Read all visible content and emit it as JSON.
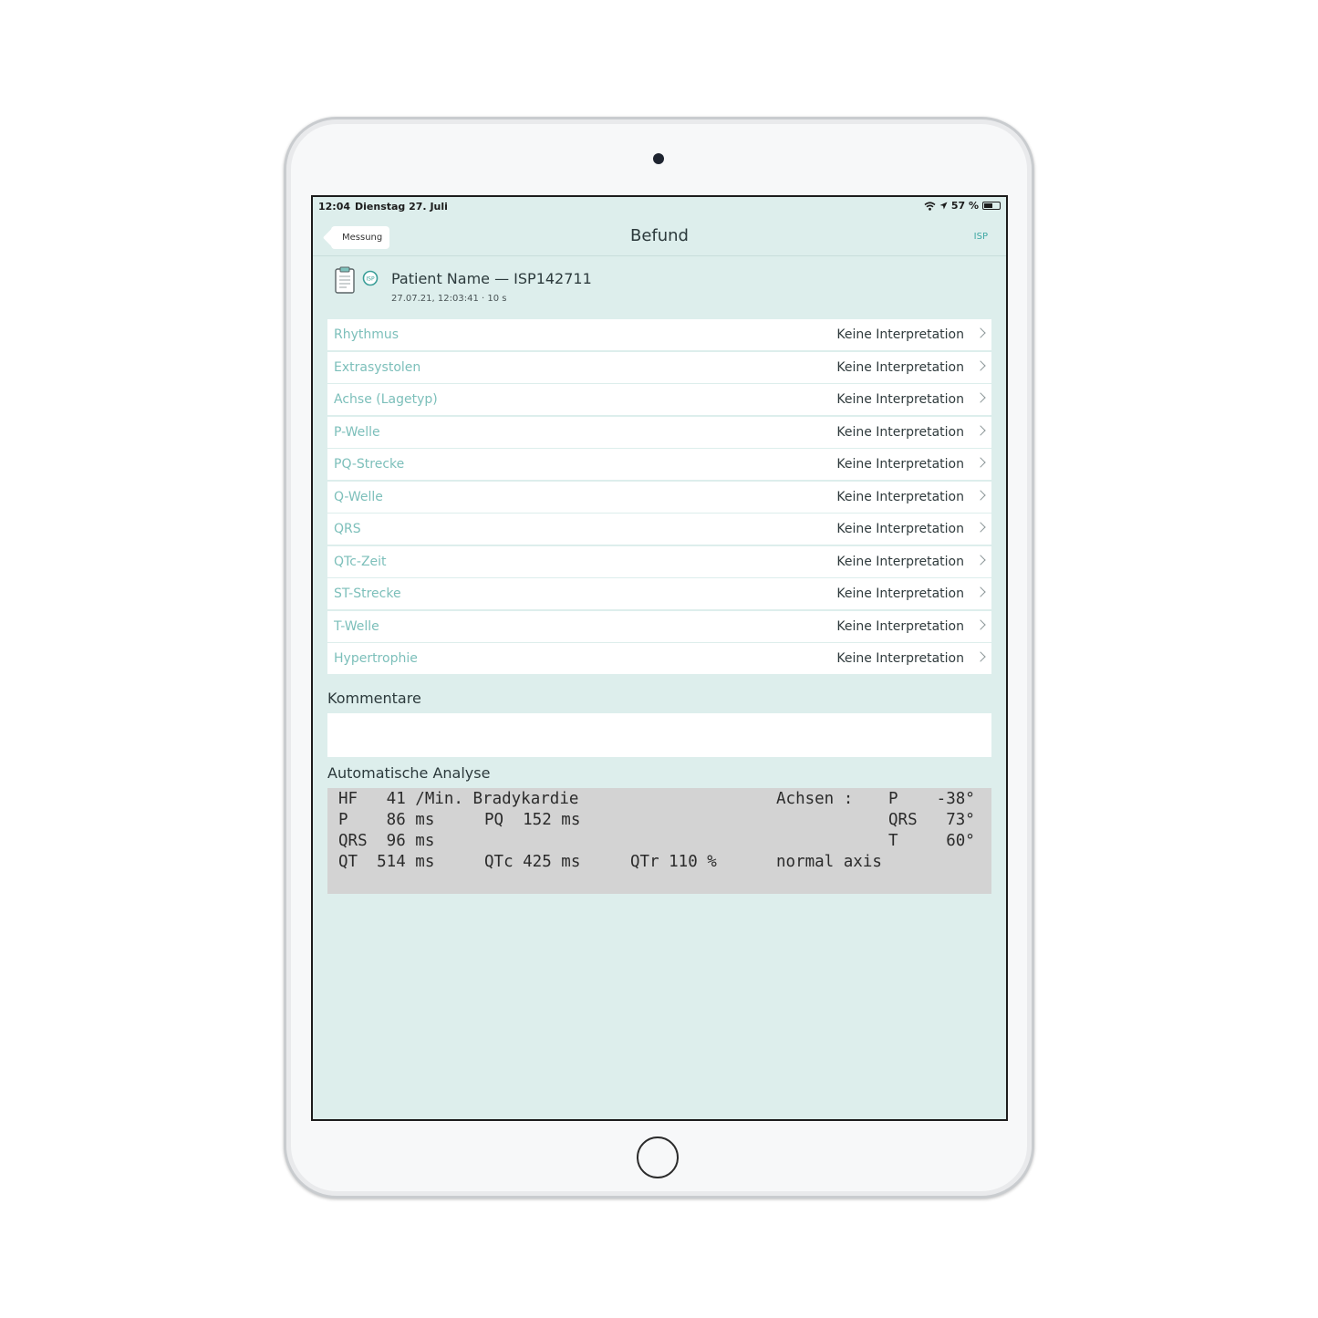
{
  "status_bar": {
    "time": "12:04",
    "date": "Dienstag 27. Juli",
    "battery": "57 %",
    "battery_level": 0.57
  },
  "nav": {
    "back_label": "Messung",
    "title": "Befund",
    "right_label": "ISP"
  },
  "patient": {
    "name": "Patient Name — ISP142711",
    "meta": "27.07.21, 12:03:41 · 10 s",
    "icon_label": "ISP"
  },
  "findings": [
    {
      "label": "Rhythmus",
      "value": "Keine Interpretation"
    },
    {
      "label": "Extrasystolen",
      "value": "Keine Interpretation"
    },
    {
      "label": "Achse (Lagetyp)",
      "value": "Keine Interpretation"
    },
    {
      "label": "P-Welle",
      "value": "Keine Interpretation"
    },
    {
      "label": "PQ-Strecke",
      "value": "Keine Interpretation"
    },
    {
      "label": "Q-Welle",
      "value": "Keine Interpretation"
    },
    {
      "label": "QRS",
      "value": "Keine Interpretation"
    },
    {
      "label": "QTc-Zeit",
      "value": "Keine Interpretation"
    },
    {
      "label": "ST-Strecke",
      "value": "Keine Interpretation"
    },
    {
      "label": "T-Welle",
      "value": "Keine Interpretation"
    },
    {
      "label": "Hypertrophie",
      "value": "Keine Interpretation"
    }
  ],
  "comments": {
    "title": "Kommentare",
    "value": ""
  },
  "analysis": {
    "title": "Automatische Analyse",
    "hf": "HF   41 /Min. Bradykardie",
    "p": "P    86 ms",
    "pq": "PQ  152 ms",
    "qrs": "QRS  96 ms",
    "qt": "QT  514 ms",
    "qtc": "QTc 425 ms",
    "qtr": "QTr 110 %",
    "axes_label": "Achsen :",
    "axis_p": "P    -38°",
    "axis_qrs": "QRS   73°",
    "axis_t": "T     60°",
    "axis_text": "normal axis"
  }
}
